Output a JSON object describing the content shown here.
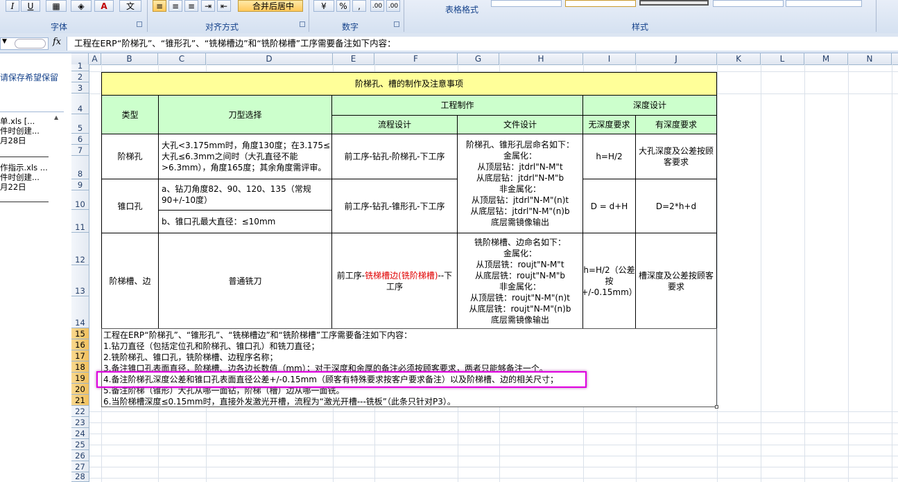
{
  "ribbon": {
    "groups": {
      "font": "字体",
      "alignment": "对齐方式",
      "number": "数字",
      "styles": "样式"
    },
    "merge_center_label": "合并后居中",
    "table_format_label": "表格格式",
    "percent_label": "%",
    "comma_label": ",",
    "italic_label": "I",
    "underline_label": "U",
    "font_color_label": "A",
    "wen_label": "文",
    "inc_decimal_label": ".00",
    "dec_decimal_label": ".00"
  },
  "formula_bar": {
    "fx": "fx",
    "content": "工程在ERP“阶梯孔”、“锥形孔”、“铣梯槽边”和“铣阶梯槽”工序需要备注如下内容："
  },
  "left_pane": {
    "message": "请保存希望保留",
    "files": [
      {
        "name": "单.xls  [...",
        "created": "件时创建...",
        "date": "月28日"
      },
      {
        "name": "作指示.xls ...",
        "created": "件时创建...",
        "date": "月22日"
      }
    ]
  },
  "columns": [
    "A",
    "B",
    "C",
    "D",
    "E",
    "F",
    "G",
    "H",
    "I",
    "J",
    "K",
    "L",
    "M",
    "N"
  ],
  "rows": [
    "1",
    "2",
    "3",
    "4",
    "5",
    "6",
    "7",
    "8",
    "9",
    "10",
    "11",
    "12",
    "13",
    "14",
    "15",
    "16",
    "17",
    "18",
    "19",
    "20",
    "21",
    "22",
    "23",
    "24",
    "25",
    "26",
    "27",
    "28"
  ],
  "sheet": {
    "title": "阶梯孔、槽的制作及注意事项",
    "headers": {
      "type": "类型",
      "tool": "刀型选择",
      "eng": "工程制作",
      "flow": "流程设计",
      "file": "文件设计",
      "depth": "深度设计",
      "no_depth": "无深度要求",
      "has_depth": "有深度要求"
    },
    "row_step": {
      "type": "阶梯孔",
      "tool": "大孔<3.175mm时，角度130度；在3.175≤大孔≤6.3mm之间时（大孔直径不能>6.3mm），角度165度；其余角度需评审。",
      "flow": "前工序-钻孔-阶梯孔-下工序",
      "no_depth": "h=H/2",
      "has_depth": "大孔深度及公差按顾客要求"
    },
    "file_hole": [
      "阶梯孔、锥形孔层命名如下：",
      "金属化：",
      "从顶层钻：jtdrl\"N-M\"t",
      "从底层钻：jtdrl\"N-M\"b",
      "非金属化：",
      "从顶层钻：jtdrl\"N-M\"(n)t",
      "从底层钻：jtdrl\"N-M\"(n)b",
      "底层需镜像输出"
    ],
    "row_cone": {
      "type": "锥口孔",
      "tool_a": "a、钻刀角度82、90、120、135（常规90+/-10度）",
      "tool_b": "b、锥口孔最大直径：≤10mm",
      "flow": "前工序-钻孔-锥形孔-下工序",
      "no_depth": "D = d+H",
      "has_depth": "D=2*h+d"
    },
    "row_slot": {
      "type": "阶梯槽、边",
      "tool": "普通铣刀",
      "flow_pre": "前工序-",
      "flow_red": "铣梯槽边(铣阶梯槽)",
      "flow_post": "--下工序",
      "no_depth": "h=H/2（公差按+/-0.15mm）",
      "has_depth": "槽深度及公差按顾客要求"
    },
    "file_slot": [
      "铣阶梯槽、边命名如下：",
      "金属化：",
      "从顶层铣：roujt\"N-M\"t",
      "从底层铣：roujt\"N-M\"b",
      "非金属化：",
      "从顶层铣：roujt\"N-M\"(n)t",
      "从底层铣：roujt\"N-M\"(n)b",
      "底层需镜像输出"
    ],
    "notes": [
      "工程在ERP“阶梯孔”、“锥形孔”、“铣梯槽边”和“铣阶梯槽”工序需要备注如下内容：",
      "1.钻刀直径（包括定位孔和阶梯孔、锥口孔）和铣刀直径；",
      "2.铣阶梯孔、锥口孔，铣阶梯槽、边程序名称；",
      "3.备注锥口孔表面直径，阶梯槽、边各边长数值（mm）；对于深度和余厚的备注必须按顾客要求，两者只能够备注一个。",
      "4.备注阶梯孔深度公差和锥口孔表面直径公差+/-0.15mm（顾客有特殊要求按客户要求备注）以及阶梯槽、边的相关尺寸；",
      "5.备注阶梯（锥形）大孔从哪一面钻，阶梯（槽）边从哪一面铣。",
      "6.当阶梯槽深度≤0.15mm时，直接外发激光开槽，流程为“激光开槽---铣板”（此条只针对P3）。"
    ]
  },
  "colors": {
    "title_fill": "#ffff99",
    "header_fill": "#ccffcc",
    "highlight": "#e000e0",
    "selected_header": "#f1c15f"
  }
}
